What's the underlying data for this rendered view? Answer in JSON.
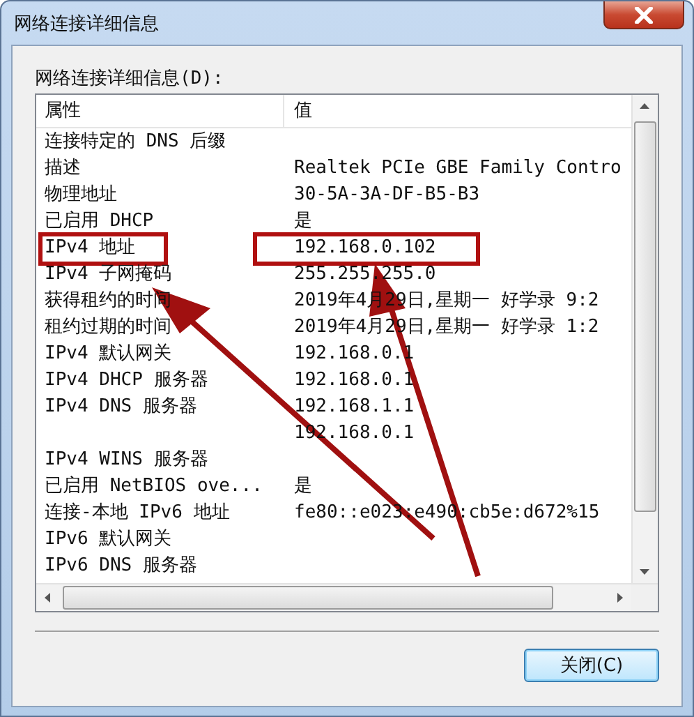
{
  "window": {
    "title": "网络连接详细信息"
  },
  "list_label": "网络连接详细信息(D):",
  "table": {
    "columns": [
      "属性",
      "值"
    ],
    "rows": [
      {
        "property": "连接特定的 DNS 后缀"
      },
      {
        "property": "描述",
        "value": "Realtek PCIe GBE Family Contro"
      },
      {
        "property": "物理地址",
        "value": "30-5A-3A-DF-B5-B3"
      },
      {
        "property": "已启用 DHCP",
        "value": "是"
      },
      {
        "property": "IPv4 地址",
        "value": "192.168.0.102"
      },
      {
        "property": "IPv4 子网掩码",
        "value": "255.255.255.0"
      },
      {
        "property": "获得租约的时间",
        "value": "2019年4月29日,星期一 好学录 9:2"
      },
      {
        "property": "租约过期的时间",
        "value": "2019年4月29日,星期一 好学录 1:2"
      },
      {
        "property": "IPv4 默认网关",
        "value": "192.168.0.1"
      },
      {
        "property": "IPv4 DHCP 服务器",
        "value": "192.168.0.1"
      },
      {
        "property": "IPv4 DNS 服务器",
        "value": "192.168.1.1"
      },
      {
        "value": "192.168.0.1"
      },
      {
        "property": "IPv4 WINS 服务器"
      },
      {
        "property": "已启用 NetBIOS ove...",
        "value": "是"
      },
      {
        "property": "连接-本地 IPv6 地址",
        "value": "fe80::e023:e490:cb5e:d672%15"
      },
      {
        "property": "IPv6 默认网关"
      },
      {
        "property": "IPv6 DNS 服务器"
      }
    ]
  },
  "buttons": [
    {
      "label": "关闭(C)"
    }
  ]
}
